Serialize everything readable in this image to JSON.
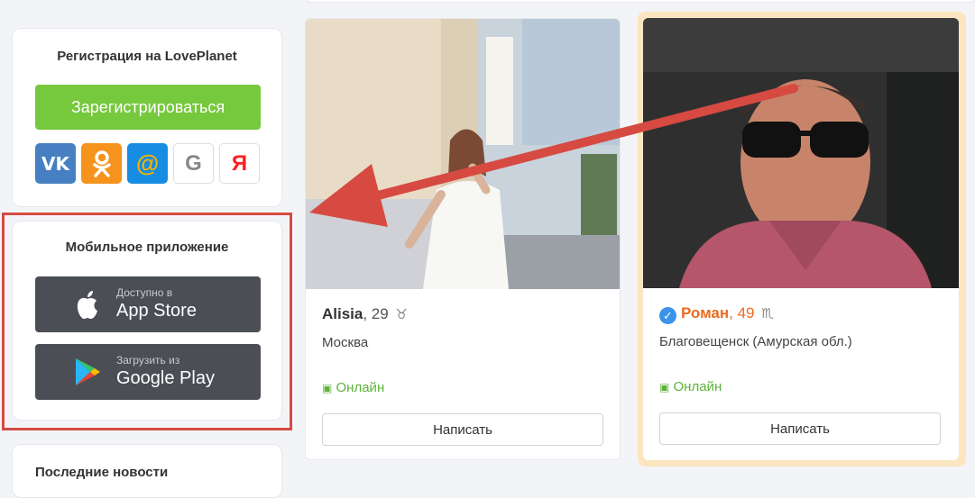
{
  "registration": {
    "title": "Регистрация на LovePlanet",
    "button_label": "Зарегистрироваться",
    "social": [
      {
        "label": "VK",
        "icon": "vk-icon",
        "color": "#4680c2"
      },
      {
        "label": "OK",
        "icon": "odnoklassniki-icon",
        "color": "#f5931d"
      },
      {
        "label": "@",
        "icon": "mailru-icon",
        "color": "#168de2"
      },
      {
        "label": "G",
        "icon": "google-icon",
        "color": "#ffffff"
      },
      {
        "label": "Я",
        "icon": "yandex-icon",
        "color": "#ffffff"
      }
    ]
  },
  "mobile_app": {
    "title": "Мобильное приложение",
    "appstore": {
      "sub": "Доступно в",
      "name": "App Store"
    },
    "googleplay": {
      "sub": "Загрузить из",
      "name": "Google Play"
    }
  },
  "news": {
    "title": "Последние новости"
  },
  "profiles": [
    {
      "name": "Alisia",
      "age_suffix": ", 29",
      "zodiac": "♉",
      "city": "Москва",
      "status": "Онлайн",
      "write_label": "Написать",
      "verified": false
    },
    {
      "name": "Роман",
      "age_suffix": ", 49",
      "zodiac": "♏",
      "city": "Благовещенск (Амурская обл.)",
      "status": "Онлайн",
      "write_label": "Написать",
      "verified": true
    }
  ],
  "colors": {
    "accent_green": "#76c83d",
    "online_green": "#5cb338",
    "highlight_red": "#d64a42",
    "featured_name": "#ee6b1f"
  }
}
